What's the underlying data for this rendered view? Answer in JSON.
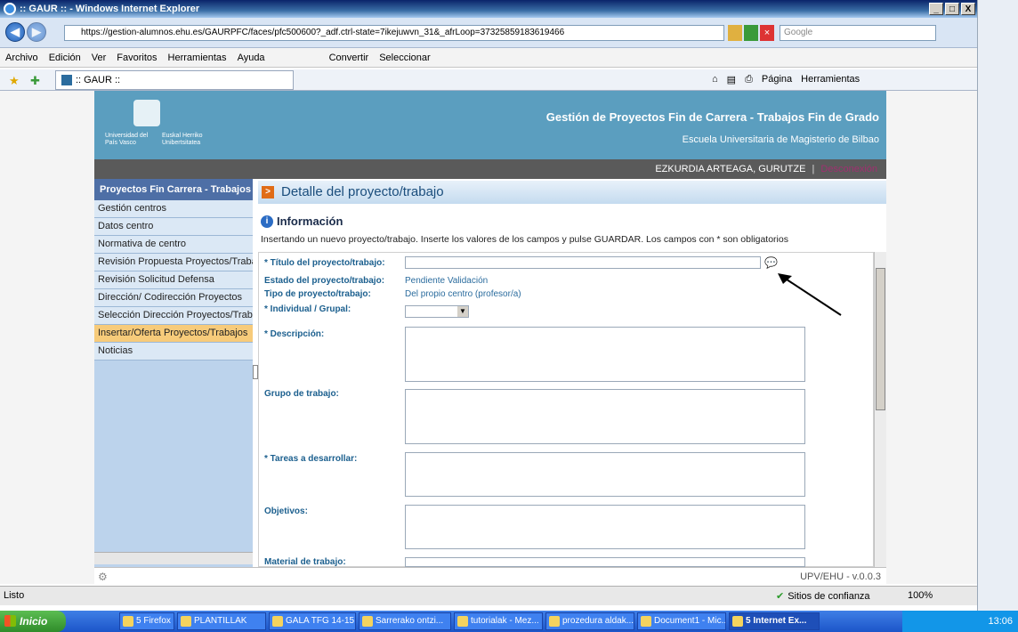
{
  "window": {
    "title": ":: GAUR :: - Windows Internet Explorer",
    "btn_min": "_",
    "btn_max": "□",
    "btn_close": "X"
  },
  "browser": {
    "url": "https://gestion-alumnos.ehu.es/GAURPFC/faces/pfc500600?_adf.ctrl-state=7ikejuwvn_31&_afrLoop=37325859183619466",
    "search_placeholder": "Google",
    "menu": [
      "Archivo",
      "Edición",
      "Ver",
      "Favoritos",
      "Herramientas",
      "Ayuda"
    ],
    "convert_label": "Convertir",
    "select_label": "Seleccionar",
    "tab_title": ":: GAUR ::",
    "tools": {
      "page": "Página",
      "tools": "Herramientas"
    }
  },
  "site": {
    "title": "Gestión de Proyectos Fin de Carrera - Trabajos Fin de Grado",
    "subtitle": "Escuela Universitaria de Magisterio de Bilbao",
    "logo_text_1": "Universidad del País Vasco",
    "logo_text_2": "Euskal Herriko Unibertsitatea",
    "user": "EZKURDIA ARTEAGA, GURUTZE",
    "logout": "Desconexión",
    "version": "UPV/EHU - v.0.0.3"
  },
  "sidebar": {
    "header": "Proyectos Fin Carrera - Trabajos",
    "items": [
      {
        "label": "Gestión centros"
      },
      {
        "label": "Datos centro"
      },
      {
        "label": "Normativa de centro"
      },
      {
        "label": "Revisión Propuesta Proyectos/Trabajos"
      },
      {
        "label": "Revisión Solicitud Defensa"
      },
      {
        "label": "Dirección/ Codirección Proyectos"
      },
      {
        "label": "Selección Dirección Proyectos/Trabajos"
      },
      {
        "label": "Insertar/Oferta Proyectos/Trabajos"
      },
      {
        "label": "Noticias"
      }
    ]
  },
  "main": {
    "heading": "Detalle del proyecto/trabajo",
    "info_title": "Información",
    "info_text": "Insertando un nuevo proyecto/trabajo. Inserte los valores de los campos y pulse GUARDAR. Los campos con * son obligatorios",
    "fields": {
      "titulo": "* Título del proyecto/trabajo:",
      "estado": "Estado del proyecto/trabajo:",
      "estado_val": "Pendiente Validación",
      "tipo": "Tipo de proyecto/trabajo:",
      "tipo_val": "Del propio centro (profesor/a)",
      "individual": "* Individual / Grupal:",
      "descripcion": "* Descripción:",
      "grupo": "Grupo de trabajo:",
      "tareas": "* Tareas a desarrollar:",
      "objetivos": "Objetivos:",
      "material": "Material de trabajo:"
    }
  },
  "status": {
    "text": "Listo",
    "zone": "Sitios de confianza",
    "zoom": "100%"
  },
  "taskbar": {
    "start": "Inicio",
    "items": [
      "5 Firefox",
      "PLANTILLAK",
      "GALA TFG 14-15",
      "Sarrerako ontzi...",
      "tutorialak - Mez...",
      "prozedura aldak...",
      "Document1 - Mic...",
      "5 Internet Ex..."
    ],
    "clock": "13:06"
  }
}
